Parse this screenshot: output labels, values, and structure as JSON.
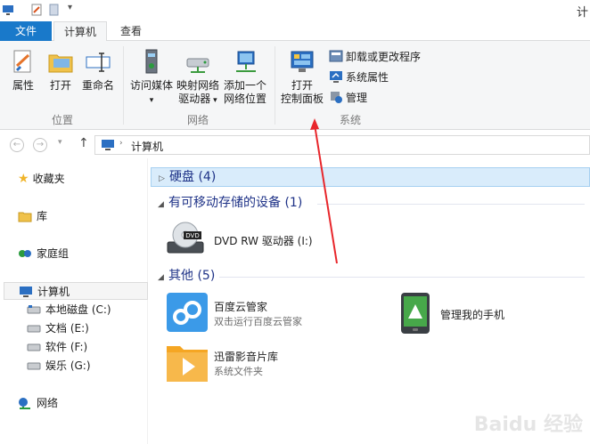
{
  "titlebar": {
    "edge_char": "计"
  },
  "tabs": {
    "file": "文件",
    "computer": "计算机",
    "view": "查看"
  },
  "ribbon": {
    "location": {
      "label": "位置",
      "properties": "属性",
      "open": "打开",
      "rename": "重命名"
    },
    "network": {
      "label": "网络",
      "access_media": "访问媒体",
      "map_drive_line1": "映射网络",
      "map_drive_line2": "驱动器",
      "add_location_line1": "添加一个",
      "add_location_line2": "网络位置"
    },
    "system": {
      "label": "系统",
      "open_cp_line1": "打开",
      "open_cp_line2": "控制面板",
      "uninstall": "卸载或更改程序",
      "sys_props": "系统属性",
      "manage": "管理"
    }
  },
  "address": {
    "path": "计算机"
  },
  "nav": {
    "favorites": "收藏夹",
    "libraries": "库",
    "homegroup": "家庭组",
    "computer": "计算机",
    "drive_c": "本地磁盘 (C:)",
    "drive_e": "文档 (E:)",
    "drive_f": "软件 (F:)",
    "drive_g": "娱乐 (G:)",
    "network": "网络"
  },
  "content": {
    "hdd_group": "硬盘 (4)",
    "removable_group": "有可移动存储的设备 (1)",
    "dvd_name": "DVD RW 驱动器 (I:)",
    "other_group": "其他 (5)",
    "items": {
      "baidu_name": "百度云管家",
      "baidu_sub": "双击运行百度云管家",
      "phone_name": "管理我的手机",
      "xunlei_name": "迅雷影音片库",
      "xunlei_sub": "系统文件夹"
    }
  },
  "watermark": "Baidu 经验",
  "colors": {
    "accent": "#1979ca",
    "group_header": "#1e3287",
    "arrow": "#e8262b"
  }
}
